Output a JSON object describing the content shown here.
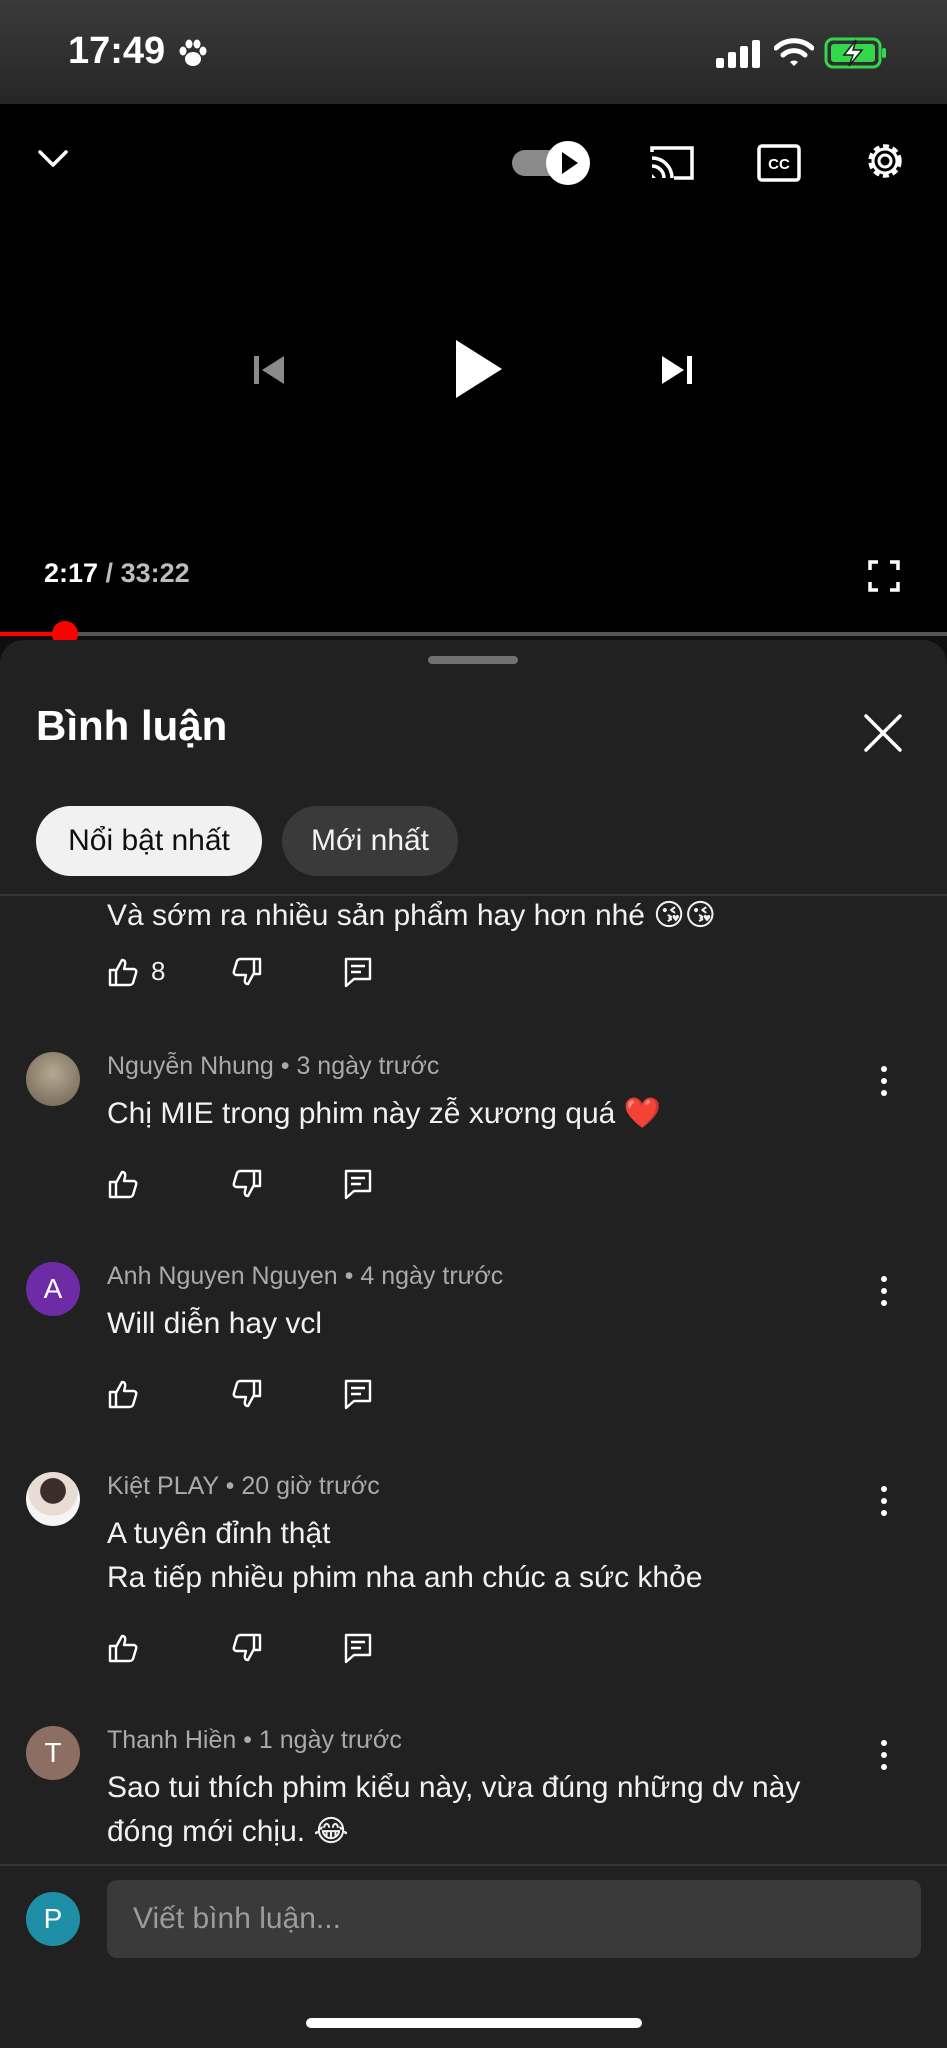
{
  "status_bar": {
    "time": "17:49",
    "icons": [
      "paw-icon",
      "signal-icon",
      "wifi-icon",
      "battery-charging-icon"
    ],
    "battery_color": "#32d74b"
  },
  "player": {
    "current_time": "2:17",
    "separator": " / ",
    "duration": "33:22",
    "progress_fraction": 0.0685,
    "accent": "#ff0000",
    "icons": [
      "chevron-down-icon",
      "autoplay-toggle",
      "cast-icon",
      "cc-icon",
      "gear-icon",
      "skip-previous-icon",
      "play-icon",
      "skip-next-icon",
      "fullscreen-icon"
    ]
  },
  "comments_panel": {
    "title": "Bình luận",
    "chips": [
      {
        "label": "Nổi bật nhất",
        "active": true
      },
      {
        "label": "Mới nhất",
        "active": false
      }
    ]
  },
  "comments": [
    {
      "partial": true,
      "text": "Và sớm ra nhiều sản phẩm hay  hơn nhé 😘😘",
      "likes": "8"
    },
    {
      "author": "Nguyễn Nhung",
      "time": "3 ngày trước",
      "avatar_letter": "",
      "avatar_color": "#8c8170",
      "lines": [
        "Chị MIE trong phim này zễ xương quá ❤️"
      ],
      "likes": ""
    },
    {
      "author": "Anh Nguyen Nguyen",
      "time": "4 ngày trước",
      "avatar_letter": "A",
      "avatar_color": "#6e2ba6",
      "lines": [
        "Will diễn hay vcl"
      ],
      "likes": ""
    },
    {
      "author": "Kiệt PLAY",
      "time": "20 giờ trước",
      "avatar_letter": "",
      "avatar_color": "#d8d8d8",
      "lines": [
        "A tuyên đỉnh thật",
        "Ra tiếp nhiều phim nha anh chúc a sức khỏe"
      ],
      "likes": ""
    },
    {
      "author": "Thanh Hiền",
      "time": "1 ngày trước",
      "avatar_letter": "T",
      "avatar_color": "#8d6e63",
      "lines": [
        "Sao tui thích phim kiểu này, vừa đúng những dv này",
        "đóng mới chịu. 😂"
      ],
      "likes": ""
    }
  ],
  "composer": {
    "avatar_letter": "P",
    "avatar_color": "#1e8fa6",
    "placeholder": "Viết bình luận..."
  }
}
